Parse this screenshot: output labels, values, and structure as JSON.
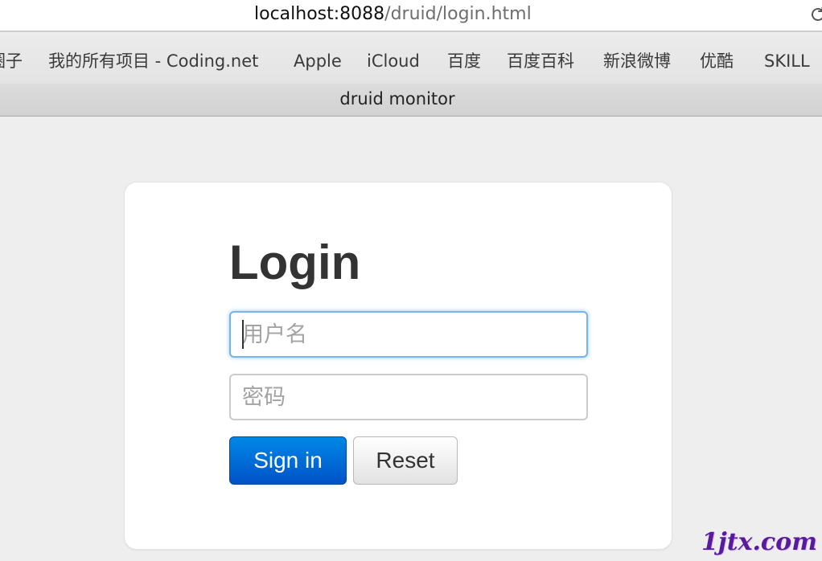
{
  "browser": {
    "url_host": "localhost:8088",
    "url_path": "/druid/login.html",
    "reload_icon": "reload-icon",
    "bookmarks": [
      "圈子",
      "我的所有项目 - Coding.net",
      "Apple",
      "iCloud",
      "百度",
      "百度百科",
      "新浪微博",
      "优酷",
      "SKILL"
    ],
    "tab_title": "druid monitor"
  },
  "login": {
    "heading": "Login",
    "username_placeholder": "用户名",
    "password_placeholder": "密码",
    "signin_label": "Sign in",
    "reset_label": "Reset"
  },
  "watermark": "1jtx.com",
  "colors": {
    "primary_button": "#0066d6",
    "focus_border": "#78b3ec",
    "heading_text": "#333333",
    "page_background": "#eeeeee"
  }
}
